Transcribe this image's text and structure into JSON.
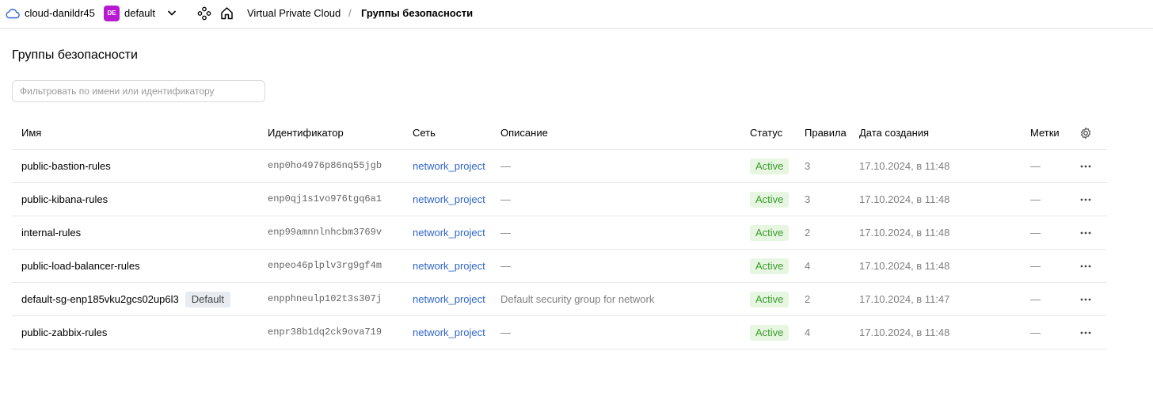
{
  "topbar": {
    "cloud_name": "cloud-danildr45",
    "folder_badge": "DE",
    "folder_name": "default",
    "breadcrumb": {
      "service": "Virtual Private Cloud",
      "separator": "/",
      "current": "Группы безопасности"
    },
    "icons": [
      "cloud-icon",
      "chevron-down-icon",
      "services-icon",
      "home-icon"
    ]
  },
  "page": {
    "title": "Группы безопасности",
    "filter_placeholder": "Фильтровать по имени или идентификатору",
    "filter_value": ""
  },
  "table": {
    "headers": {
      "name": "Имя",
      "id": "Идентификатор",
      "network": "Сеть",
      "description": "Описание",
      "status": "Статус",
      "rules": "Правила",
      "created": "Дата создания",
      "labels": "Метки"
    },
    "rows": [
      {
        "name": "public-bastion-rules",
        "tag": "",
        "id": "enp0ho4976p86nq55jgb",
        "network": "network_project",
        "description": "—",
        "status": "Active",
        "rules": "3",
        "created": "17.10.2024, в 11:48",
        "labels": "—"
      },
      {
        "name": "public-kibana-rules",
        "tag": "",
        "id": "enp0qj1s1vo976tgq6a1",
        "network": "network_project",
        "description": "—",
        "status": "Active",
        "rules": "3",
        "created": "17.10.2024, в 11:48",
        "labels": "—"
      },
      {
        "name": "internal-rules",
        "tag": "",
        "id": "enp99amnnlnhcbm3769v",
        "network": "network_project",
        "description": "—",
        "status": "Active",
        "rules": "2",
        "created": "17.10.2024, в 11:48",
        "labels": "—"
      },
      {
        "name": "public-load-balancer-rules",
        "tag": "",
        "id": "enpeo46plplv3rg9gf4m",
        "network": "network_project",
        "description": "—",
        "status": "Active",
        "rules": "4",
        "created": "17.10.2024, в 11:48",
        "labels": "—"
      },
      {
        "name": "default-sg-enp185vku2gcs02up6l3",
        "tag": "Default",
        "id": "enpphneulp102t3s307j",
        "network": "network_project",
        "description": "Default security group for network",
        "status": "Active",
        "rules": "2",
        "created": "17.10.2024, в 11:47",
        "labels": "—"
      },
      {
        "name": "public-zabbix-rules",
        "tag": "",
        "id": "enpr38b1dq2ck9ova719",
        "network": "network_project",
        "description": "—",
        "status": "Active",
        "rules": "4",
        "created": "17.10.2024, в 11:48",
        "labels": "—"
      }
    ]
  },
  "colors": {
    "link": "#2f65c8",
    "status_bg": "#e6f6e1",
    "status_text": "#3b9b2c",
    "folder_badge": "#b71bd1"
  }
}
